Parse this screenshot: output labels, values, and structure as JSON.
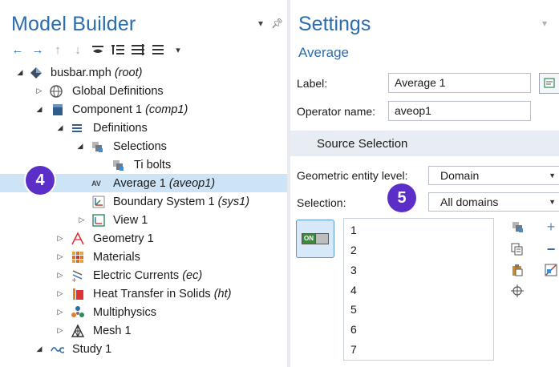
{
  "model_builder": {
    "title": "Model Builder",
    "header_controls": [
      "▾",
      "⊕"
    ],
    "toolbar": [
      {
        "icon": "arrow-left-icon",
        "glyph": "🡐"
      },
      {
        "icon": "arrow-right-icon",
        "glyph": "🡒"
      },
      {
        "icon": "arrow-up-icon",
        "glyph": "↑"
      },
      {
        "icon": "arrow-down-icon",
        "glyph": "↓"
      },
      {
        "icon": "show-icon",
        "glyph": "≂"
      },
      {
        "icon": "expand-icon",
        "glyph": "≣"
      },
      {
        "icon": "collapse-icon",
        "glyph": "≡"
      },
      {
        "icon": "list-icon",
        "glyph": "≣"
      },
      {
        "icon": "dropdown-icon",
        "glyph": "▾"
      }
    ],
    "tree": [
      {
        "label": "busbar.mph",
        "tag": "(root)",
        "depth": 0,
        "expander": "◢",
        "icon": "◆"
      },
      {
        "label": "Global Definitions",
        "tag": "",
        "depth": 1,
        "expander": "▷",
        "icon": "⊕"
      },
      {
        "label": "Component 1",
        "tag": "(comp1)",
        "depth": 1,
        "expander": "◢",
        "icon": "▆"
      },
      {
        "label": "Definitions",
        "tag": "",
        "depth": 2,
        "expander": "◢",
        "icon": "≡"
      },
      {
        "label": "Selections",
        "tag": "",
        "depth": 3,
        "expander": "◢",
        "icon": "⬚"
      },
      {
        "label": "Ti bolts",
        "tag": "",
        "depth": 4,
        "expander": "",
        "icon": "⬚"
      },
      {
        "label": "Average 1",
        "tag": "(aveop1)",
        "depth": 3,
        "expander": "",
        "icon": "AV",
        "selected": true
      },
      {
        "label": "Boundary System 1",
        "tag": "(sys1)",
        "depth": 3,
        "expander": "",
        "icon": "⟂"
      },
      {
        "label": "View 1",
        "tag": "",
        "depth": 3,
        "expander": "▷",
        "icon": "⊡"
      },
      {
        "label": "Geometry 1",
        "tag": "",
        "depth": 2,
        "expander": "▷",
        "icon": "⋀"
      },
      {
        "label": "Materials",
        "tag": "",
        "depth": 2,
        "expander": "▷",
        "icon": "▦"
      },
      {
        "label": "Electric Currents",
        "tag": "(ec)",
        "depth": 2,
        "expander": "▷",
        "icon": "⚡"
      },
      {
        "label": "Heat Transfer in Solids",
        "tag": "(ht)",
        "depth": 2,
        "expander": "▷",
        "icon": "▌"
      },
      {
        "label": "Multiphysics",
        "tag": "",
        "depth": 2,
        "expander": "▷",
        "icon": "✣"
      },
      {
        "label": "Mesh 1",
        "tag": "",
        "depth": 2,
        "expander": "▷",
        "icon": "▲"
      },
      {
        "label": "Study 1",
        "tag": "",
        "depth": 1,
        "expander": "◢",
        "icon": "∾"
      }
    ]
  },
  "settings": {
    "title": "Settings",
    "subtitle": "Average",
    "label_caption": "Label:",
    "label_value": "Average 1",
    "operator_caption": "Operator name:",
    "operator_value": "aveop1",
    "section_title": "Source Selection",
    "entity_level_caption": "Geometric entity level:",
    "entity_level_value": "Domain",
    "selection_caption": "Selection:",
    "selection_value": "All domains",
    "toggle_label": "ON",
    "selection_items": [
      "1",
      "2",
      "3",
      "4",
      "5",
      "6",
      "7"
    ]
  },
  "badges": {
    "tree_badge": "4",
    "settings_badge": "5"
  },
  "colors": {
    "title_blue": "#2a6cb0",
    "selected_row": "#cde4f7",
    "section_bar": "#e8edf3",
    "badge_purple": "#5b2ec8"
  }
}
